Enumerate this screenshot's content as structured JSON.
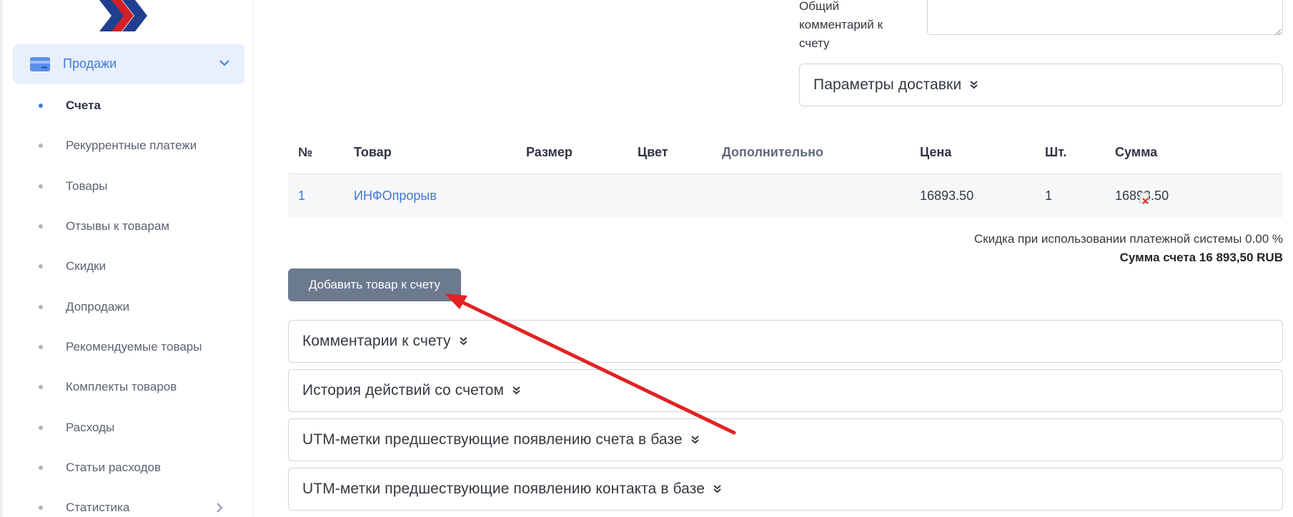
{
  "sidebar": {
    "logo_icon": "double-chevron-logo-icon",
    "group": {
      "label": "Продажи",
      "icon": "credit-card-icon",
      "expanded": true
    },
    "items": [
      {
        "label": "Счета",
        "active": true
      },
      {
        "label": "Рекуррентные платежи",
        "active": false
      },
      {
        "label": "Товары",
        "active": false
      },
      {
        "label": "Отзывы к товарам",
        "active": false
      },
      {
        "label": "Скидки",
        "active": false
      },
      {
        "label": "Допродажи",
        "active": false
      },
      {
        "label": "Рекомендуемые товары",
        "active": false
      },
      {
        "label": "Комплекты товаров",
        "active": false
      },
      {
        "label": "Расходы",
        "active": false
      },
      {
        "label": "Статьи расходов",
        "active": false
      },
      {
        "label": "Статистика",
        "active": false,
        "has_submenu": true
      }
    ]
  },
  "invoice": {
    "general_comment_label": "Общий комментарий к счету",
    "general_comment_value": "",
    "delivery_section": "Параметры доставки",
    "table": {
      "headers": [
        "№",
        "Товар",
        "Размер",
        "Цвет",
        "Дополнительно",
        "Цена",
        "Шт.",
        "Сумма"
      ],
      "rows": [
        {
          "num": "1",
          "product": "ИНФОпрорыв",
          "size": "",
          "color": "",
          "extra": "",
          "price": "16893.50",
          "qty": "1",
          "sum": "16893.50"
        }
      ]
    },
    "discount_text": "Скидка при использовании платежной системы 0.00 %",
    "total_text": "Сумма счета 16 893,50 RUB",
    "add_button": "Добавить товар к счету",
    "sections": [
      "Комментарии к счету",
      "История действий со счетом",
      "UTM-метки предшествующие появлению счета в базе",
      "UTM-метки предшествующие появлению контакта в базе"
    ]
  },
  "colors": {
    "accent": "#3f78dd",
    "sidebar_active_bg": "#e8effd",
    "button_bg": "#6c7a8e",
    "annotation_arrow": "#e32222",
    "logo_blue": "#1f3f8f",
    "logo_red": "#d42027"
  }
}
